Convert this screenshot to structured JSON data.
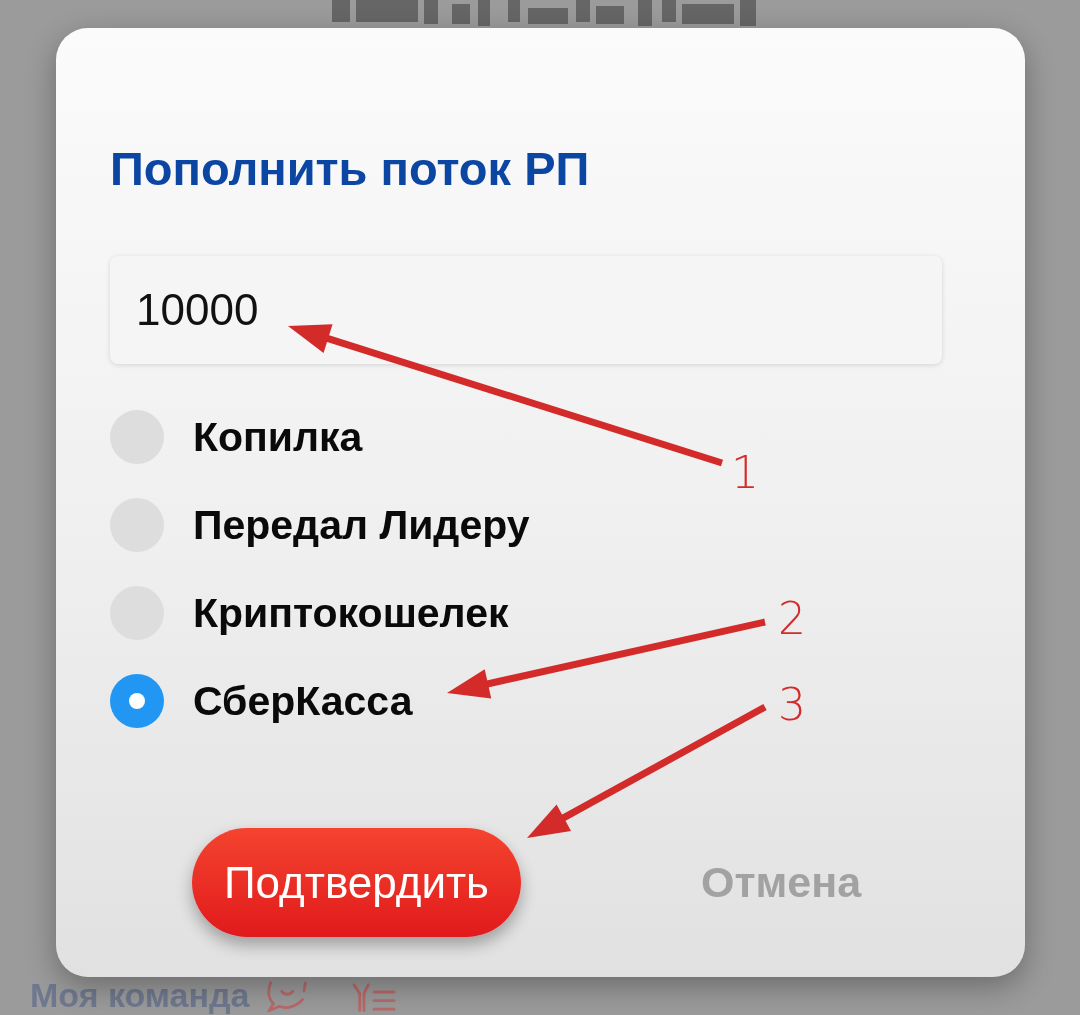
{
  "background_page": {
    "heading": "Моя команда"
  },
  "dialog": {
    "title": "Пополнить поток РП",
    "amount_field": {
      "value": "10000"
    },
    "options": [
      {
        "label": "Копилка",
        "selected": false
      },
      {
        "label": "Передал Лидеру",
        "selected": false
      },
      {
        "label": "Криптокошелек",
        "selected": false
      },
      {
        "label": "СберКасса",
        "selected": true
      }
    ],
    "buttons": [
      {
        "label": "Подтвердить",
        "kind": "primary"
      },
      {
        "label": "Отмена",
        "kind": "secondary"
      }
    ]
  },
  "annotations": [
    {
      "label": "1"
    },
    {
      "label": "2"
    },
    {
      "label": "3"
    }
  ]
}
